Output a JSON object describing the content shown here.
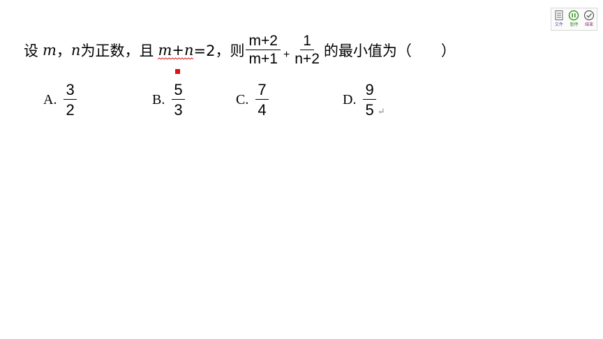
{
  "toolbar": {
    "file_label": "文件",
    "pause_label": "暂停",
    "end_label": "结束"
  },
  "question": {
    "prefix": "设",
    "var_m": "m",
    "comma1": "，",
    "var_n": "n",
    "text1": "为正数，且",
    "constraint_expr": "m+n",
    "constraint_rest": "=2，则",
    "frac1_num": "m+2",
    "frac1_den": "m+1",
    "plus": "+",
    "frac2_num": "1",
    "frac2_den": "n+2",
    "suffix": "的最小值为（　　）"
  },
  "options": [
    {
      "letter": "A.",
      "num": "3",
      "den": "2"
    },
    {
      "letter": "B.",
      "num": "5",
      "den": "3"
    },
    {
      "letter": "C.",
      "num": "7",
      "den": "4"
    },
    {
      "letter": "D.",
      "num": "9",
      "den": "5"
    }
  ],
  "return_mark": "↵"
}
